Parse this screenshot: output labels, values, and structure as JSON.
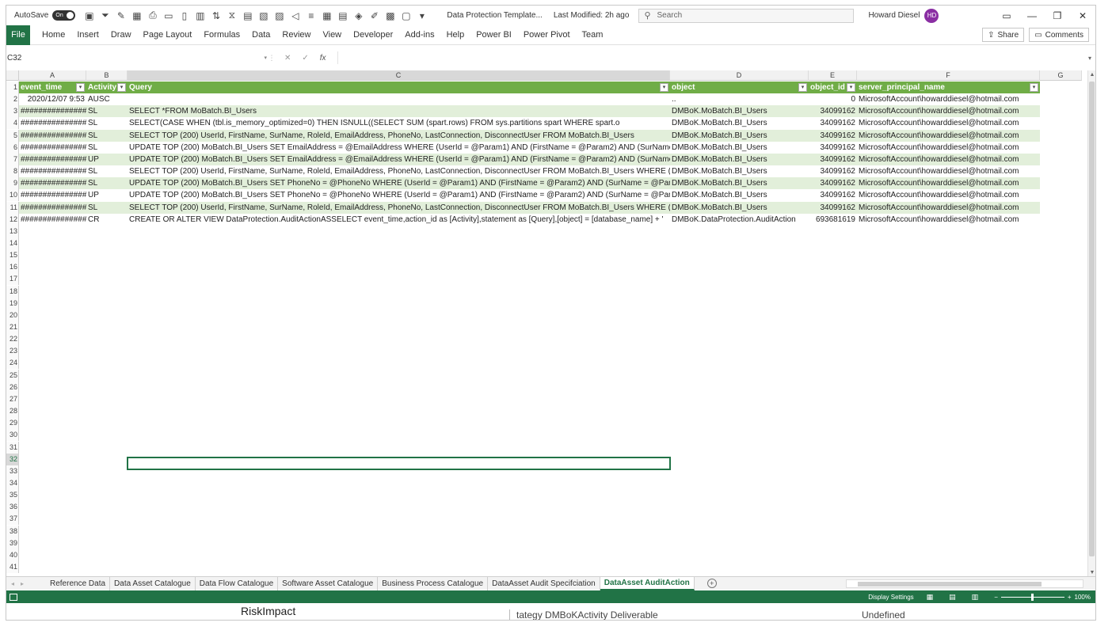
{
  "titlebar": {
    "autosave_label": "AutoSave",
    "autosave_state": "On",
    "doc_title": "Data Protection Template...",
    "last_modified": "Last Modified: 2h ago",
    "search_placeholder": "Search",
    "user_name": "Howard Diesel",
    "user_initials": "HD"
  },
  "ribbon": {
    "file": "File",
    "tabs": [
      "Home",
      "Insert",
      "Draw",
      "Page Layout",
      "Formulas",
      "Data",
      "Review",
      "View",
      "Developer",
      "Add-ins",
      "Help",
      "Power BI",
      "Power Pivot",
      "Team"
    ],
    "share": "Share",
    "comments": "Comments"
  },
  "formula_bar": {
    "name_box": "C32",
    "fx": "fx",
    "content": ""
  },
  "columns": [
    "A",
    "B",
    "C",
    "D",
    "E",
    "F",
    "G"
  ],
  "table": {
    "headers": [
      "event_time",
      "Activity",
      "Query",
      "object",
      "object_id",
      "server_principal_name"
    ],
    "rows": [
      [
        "2020/12/07 9:53",
        "AUSC",
        "",
        "..",
        "0",
        "MicrosoftAccount\\howarddiesel@hotmail.com"
      ],
      [
        "###############",
        "SL",
        "SELECT *FROM MoBatch.BI_Users",
        "DMBoK.MoBatch.BI_Users",
        "34099162",
        "MicrosoftAccount\\howarddiesel@hotmail.com"
      ],
      [
        "###############",
        "SL",
        "SELECT(CASE WHEN (tbl.is_memory_optimized=0)                    THEN ISNULL((SELECT SUM (spart.rows) FROM sys.partitions spart WHERE spart.o",
        "DMBoK.MoBatch.BI_Users",
        "34099162",
        "MicrosoftAccount\\howarddiesel@hotmail.com"
      ],
      [
        "###############",
        "SL",
        "SELECT TOP (200) UserId, FirstName, SurName, RoleId, EmailAddress, PhoneNo, LastConnection, DisconnectUser FROM MoBatch.BI_Users",
        "DMBoK.MoBatch.BI_Users",
        "34099162",
        "MicrosoftAccount\\howarddiesel@hotmail.com"
      ],
      [
        "###############",
        "SL",
        "UPDATE TOP (200) MoBatch.BI_Users SET EmailAddress = @EmailAddress WHERE (UserId = @Param1) AND (FirstName = @Param2) AND (SurName =",
        "DMBoK.MoBatch.BI_Users",
        "34099162",
        "MicrosoftAccount\\howarddiesel@hotmail.com"
      ],
      [
        "###############",
        "UP",
        "UPDATE TOP (200) MoBatch.BI_Users SET EmailAddress = @EmailAddress WHERE (UserId = @Param1) AND (FirstName = @Param2) AND (SurName =",
        "DMBoK.MoBatch.BI_Users",
        "34099162",
        "MicrosoftAccount\\howarddiesel@hotmail.com"
      ],
      [
        "###############",
        "SL",
        "SELECT TOP (200) UserId, FirstName, SurName, RoleId, EmailAddress, PhoneNo, LastConnection, DisconnectUser FROM MoBatch.BI_Users WHERE (U",
        "DMBoK.MoBatch.BI_Users",
        "34099162",
        "MicrosoftAccount\\howarddiesel@hotmail.com"
      ],
      [
        "###############",
        "SL",
        "UPDATE TOP (200) MoBatch.BI_Users SET PhoneNo = @PhoneNo WHERE (UserId = @Param1) AND (FirstName = @Param2) AND (SurName = @Parai",
        "DMBoK.MoBatch.BI_Users",
        "34099162",
        "MicrosoftAccount\\howarddiesel@hotmail.com"
      ],
      [
        "###############",
        "UP",
        "UPDATE TOP (200) MoBatch.BI_Users SET PhoneNo = @PhoneNo WHERE (UserId = @Param1) AND (FirstName = @Param2) AND (SurName = @Parai",
        "DMBoK.MoBatch.BI_Users",
        "34099162",
        "MicrosoftAccount\\howarddiesel@hotmail.com"
      ],
      [
        "###############",
        "SL",
        "SELECT TOP (200) UserId, FirstName, SurName, RoleId, EmailAddress, PhoneNo, LastConnection, DisconnectUser FROM MoBatch.BI_Users WHERE (U",
        "DMBoK.MoBatch.BI_Users",
        "34099162",
        "MicrosoftAccount\\howarddiesel@hotmail.com"
      ],
      [
        "###############",
        "CR",
        "CREATE OR ALTER VIEW DataProtection.AuditActionASSELECT event_time,action_id as [Activity],statement as [Query],[object] = [database_name] + '",
        "DMBoK.DataProtection.AuditAction",
        "693681619",
        "MicrosoftAccount\\howarddiesel@hotmail.com"
      ]
    ]
  },
  "selected_cell": "C32",
  "sheets": [
    "Reference Data",
    "Data Asset Catalogue",
    "Data Flow Catalogue",
    "Software Asset Catalogue",
    "Business Process Catalogue",
    "DataAsset Audit Specifciation",
    "DataAsset AuditAction"
  ],
  "active_sheet": "DataAsset AuditAction",
  "status": {
    "display_settings": "Display Settings",
    "zoom": "100%"
  },
  "behind_window": {
    "text1": "RiskImpact",
    "text2": "tategy DMBoKActivity Deliverable",
    "text3": "Undefined"
  },
  "colors": {
    "excel_green": "#217346",
    "table_header": "#70ad47",
    "table_band": "#e2efda"
  }
}
